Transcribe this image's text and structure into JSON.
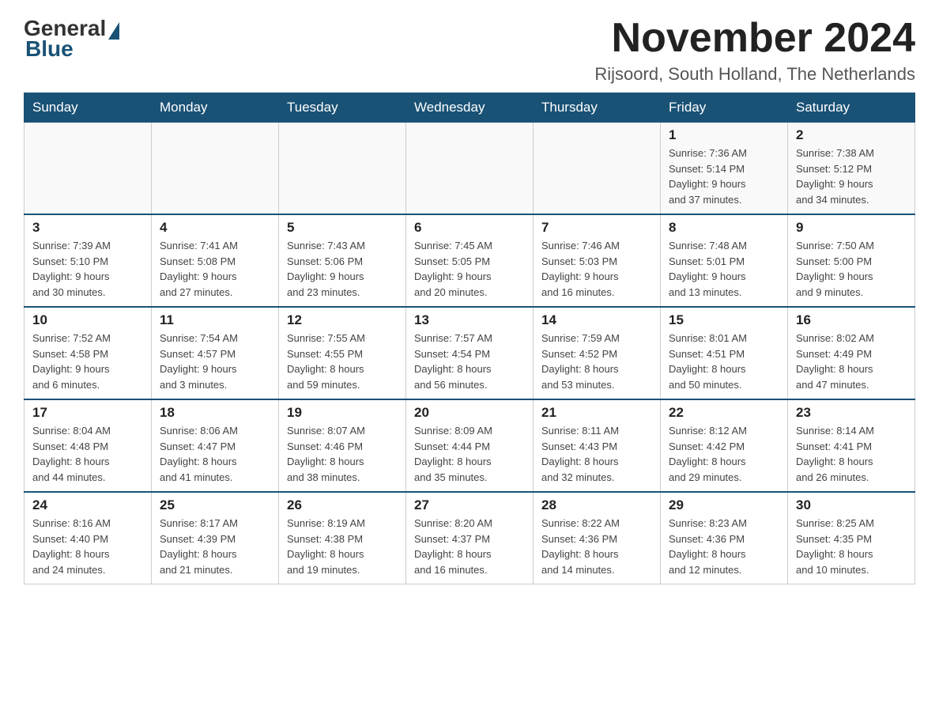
{
  "logo": {
    "text_general": "General",
    "text_blue": "Blue"
  },
  "title": {
    "month_year": "November 2024",
    "location": "Rijsoord, South Holland, The Netherlands"
  },
  "weekdays": [
    "Sunday",
    "Monday",
    "Tuesday",
    "Wednesday",
    "Thursday",
    "Friday",
    "Saturday"
  ],
  "weeks": [
    [
      {
        "day": "",
        "detail": ""
      },
      {
        "day": "",
        "detail": ""
      },
      {
        "day": "",
        "detail": ""
      },
      {
        "day": "",
        "detail": ""
      },
      {
        "day": "",
        "detail": ""
      },
      {
        "day": "1",
        "detail": "Sunrise: 7:36 AM\nSunset: 5:14 PM\nDaylight: 9 hours\nand 37 minutes."
      },
      {
        "day": "2",
        "detail": "Sunrise: 7:38 AM\nSunset: 5:12 PM\nDaylight: 9 hours\nand 34 minutes."
      }
    ],
    [
      {
        "day": "3",
        "detail": "Sunrise: 7:39 AM\nSunset: 5:10 PM\nDaylight: 9 hours\nand 30 minutes."
      },
      {
        "day": "4",
        "detail": "Sunrise: 7:41 AM\nSunset: 5:08 PM\nDaylight: 9 hours\nand 27 minutes."
      },
      {
        "day": "5",
        "detail": "Sunrise: 7:43 AM\nSunset: 5:06 PM\nDaylight: 9 hours\nand 23 minutes."
      },
      {
        "day": "6",
        "detail": "Sunrise: 7:45 AM\nSunset: 5:05 PM\nDaylight: 9 hours\nand 20 minutes."
      },
      {
        "day": "7",
        "detail": "Sunrise: 7:46 AM\nSunset: 5:03 PM\nDaylight: 9 hours\nand 16 minutes."
      },
      {
        "day": "8",
        "detail": "Sunrise: 7:48 AM\nSunset: 5:01 PM\nDaylight: 9 hours\nand 13 minutes."
      },
      {
        "day": "9",
        "detail": "Sunrise: 7:50 AM\nSunset: 5:00 PM\nDaylight: 9 hours\nand 9 minutes."
      }
    ],
    [
      {
        "day": "10",
        "detail": "Sunrise: 7:52 AM\nSunset: 4:58 PM\nDaylight: 9 hours\nand 6 minutes."
      },
      {
        "day": "11",
        "detail": "Sunrise: 7:54 AM\nSunset: 4:57 PM\nDaylight: 9 hours\nand 3 minutes."
      },
      {
        "day": "12",
        "detail": "Sunrise: 7:55 AM\nSunset: 4:55 PM\nDaylight: 8 hours\nand 59 minutes."
      },
      {
        "day": "13",
        "detail": "Sunrise: 7:57 AM\nSunset: 4:54 PM\nDaylight: 8 hours\nand 56 minutes."
      },
      {
        "day": "14",
        "detail": "Sunrise: 7:59 AM\nSunset: 4:52 PM\nDaylight: 8 hours\nand 53 minutes."
      },
      {
        "day": "15",
        "detail": "Sunrise: 8:01 AM\nSunset: 4:51 PM\nDaylight: 8 hours\nand 50 minutes."
      },
      {
        "day": "16",
        "detail": "Sunrise: 8:02 AM\nSunset: 4:49 PM\nDaylight: 8 hours\nand 47 minutes."
      }
    ],
    [
      {
        "day": "17",
        "detail": "Sunrise: 8:04 AM\nSunset: 4:48 PM\nDaylight: 8 hours\nand 44 minutes."
      },
      {
        "day": "18",
        "detail": "Sunrise: 8:06 AM\nSunset: 4:47 PM\nDaylight: 8 hours\nand 41 minutes."
      },
      {
        "day": "19",
        "detail": "Sunrise: 8:07 AM\nSunset: 4:46 PM\nDaylight: 8 hours\nand 38 minutes."
      },
      {
        "day": "20",
        "detail": "Sunrise: 8:09 AM\nSunset: 4:44 PM\nDaylight: 8 hours\nand 35 minutes."
      },
      {
        "day": "21",
        "detail": "Sunrise: 8:11 AM\nSunset: 4:43 PM\nDaylight: 8 hours\nand 32 minutes."
      },
      {
        "day": "22",
        "detail": "Sunrise: 8:12 AM\nSunset: 4:42 PM\nDaylight: 8 hours\nand 29 minutes."
      },
      {
        "day": "23",
        "detail": "Sunrise: 8:14 AM\nSunset: 4:41 PM\nDaylight: 8 hours\nand 26 minutes."
      }
    ],
    [
      {
        "day": "24",
        "detail": "Sunrise: 8:16 AM\nSunset: 4:40 PM\nDaylight: 8 hours\nand 24 minutes."
      },
      {
        "day": "25",
        "detail": "Sunrise: 8:17 AM\nSunset: 4:39 PM\nDaylight: 8 hours\nand 21 minutes."
      },
      {
        "day": "26",
        "detail": "Sunrise: 8:19 AM\nSunset: 4:38 PM\nDaylight: 8 hours\nand 19 minutes."
      },
      {
        "day": "27",
        "detail": "Sunrise: 8:20 AM\nSunset: 4:37 PM\nDaylight: 8 hours\nand 16 minutes."
      },
      {
        "day": "28",
        "detail": "Sunrise: 8:22 AM\nSunset: 4:36 PM\nDaylight: 8 hours\nand 14 minutes."
      },
      {
        "day": "29",
        "detail": "Sunrise: 8:23 AM\nSunset: 4:36 PM\nDaylight: 8 hours\nand 12 minutes."
      },
      {
        "day": "30",
        "detail": "Sunrise: 8:25 AM\nSunset: 4:35 PM\nDaylight: 8 hours\nand 10 minutes."
      }
    ]
  ]
}
